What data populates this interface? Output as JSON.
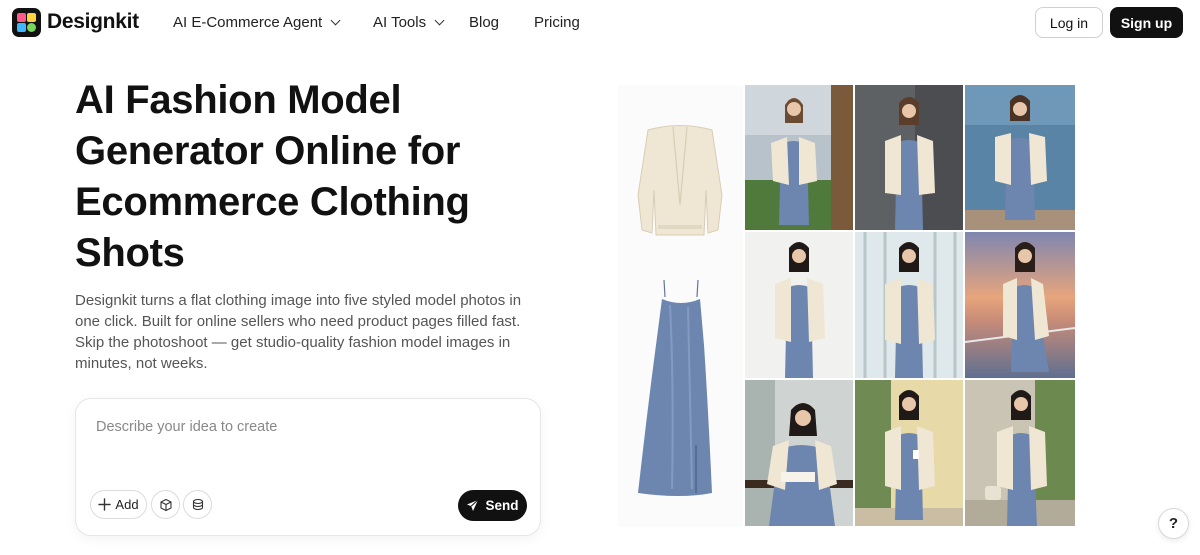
{
  "header": {
    "brand": "Designkit",
    "nav": [
      {
        "label": "AI E-Commerce Agent",
        "dropdown": true
      },
      {
        "label": "AI Tools",
        "dropdown": true
      },
      {
        "label": "Blog",
        "dropdown": false
      },
      {
        "label": "Pricing",
        "dropdown": false
      }
    ],
    "login_label": "Log in",
    "signup_label": "Sign up"
  },
  "hero": {
    "title_lines": [
      "AI Fashion Model",
      "Generator Online for",
      "Ecommerce Clothing",
      "Shots"
    ],
    "description": "Designkit turns a flat clothing image into five styled model photos in one click. Built for online sellers who need product pages filled fast. Skip the photoshoot — get studio-quality fashion model images in minutes, not weeks."
  },
  "prompt": {
    "placeholder": "Describe your idea to create",
    "value": "",
    "add_label": "Add",
    "send_label": "Send"
  },
  "gallery": {
    "products": [
      "cream-cardigan",
      "blue-satin-slip-dress"
    ],
    "model_photos": [
      "model-balcony-city",
      "model-grey-wall",
      "model-waterside",
      "model-white-studio",
      "model-glass-window",
      "model-sunset-sea",
      "model-reading-cafe",
      "model-coffee-wall",
      "model-street-bag"
    ]
  },
  "colors": {
    "primary": "#111111",
    "dress_blue": "#6d86b0",
    "cardigan_cream": "#efe6d3"
  },
  "help_label": "?"
}
